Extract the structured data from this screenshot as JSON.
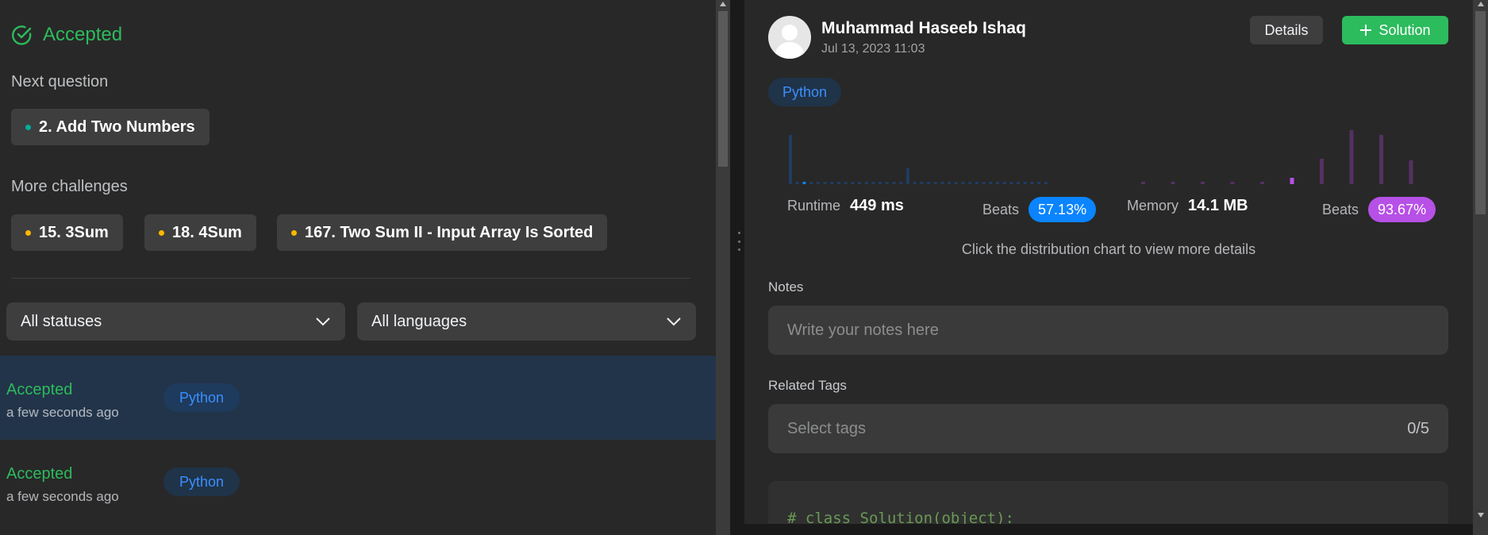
{
  "left": {
    "status_title": "Accepted",
    "next_label": "Next question",
    "next_question": {
      "title": "2. Add Two Numbers",
      "dot_color": "#00af9b"
    },
    "more_label": "More challenges",
    "challenges": [
      {
        "title": "15. 3Sum",
        "dot_color": "#ffb800"
      },
      {
        "title": "18. 4Sum",
        "dot_color": "#ffb800"
      },
      {
        "title": "167. Two Sum II - Input Array Is Sorted",
        "dot_color": "#ffb800"
      }
    ],
    "filters": {
      "status": "All statuses",
      "language": "All languages"
    },
    "submissions": [
      {
        "status": "Accepted",
        "time": "a few seconds ago",
        "language": "Python",
        "selected": true
      },
      {
        "status": "Accepted",
        "time": "a few seconds ago",
        "language": "Python",
        "selected": false
      }
    ]
  },
  "right": {
    "user": {
      "name": "Muhammad Haseeb Ishaq",
      "date": "Jul 13, 2023 11:03"
    },
    "details_label": "Details",
    "solution_label": "Solution",
    "language": "Python",
    "runtime": {
      "label": "Runtime",
      "value": "449 ms",
      "beats_label": "Beats",
      "beats": "57.13%",
      "color": "#0a84ff"
    },
    "memory": {
      "label": "Memory",
      "value": "14.1 MB",
      "beats_label": "Beats",
      "beats": "93.67%",
      "color": "#b750e6"
    },
    "chart_hint": "Click the distribution chart to view more details",
    "notes_label": "Notes",
    "notes_placeholder": "Write your notes here",
    "tags_label": "Related Tags",
    "tags_placeholder": "Select tags",
    "tags_count": "0/5",
    "code_line": "# class Solution(object):"
  },
  "colors": {
    "accent_green": "#2cbb5d",
    "python_blue": "#3b8ffe"
  }
}
